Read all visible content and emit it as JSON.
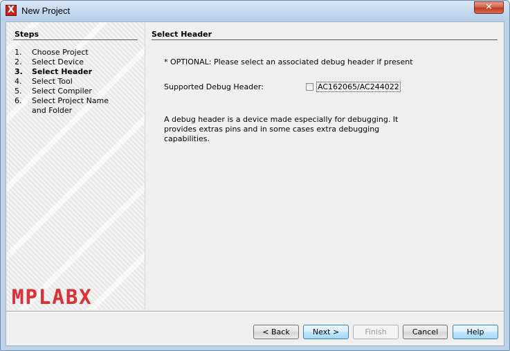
{
  "window": {
    "title": "New Project",
    "app_icon": "mplab-x-icon",
    "app_icon_glyph": "X",
    "close_glyph": "✕"
  },
  "steps": {
    "title": "Steps",
    "current_index": 2,
    "items": [
      {
        "num": "1.",
        "label": "Choose Project"
      },
      {
        "num": "2.",
        "label": "Select Device"
      },
      {
        "num": "3.",
        "label": "Select Header"
      },
      {
        "num": "4.",
        "label": "Select Tool"
      },
      {
        "num": "5.",
        "label": "Select Compiler"
      },
      {
        "num": "6.",
        "label": "Select Project Name and Folder"
      }
    ],
    "logo_text": "MPLABX"
  },
  "content": {
    "title": "Select Header",
    "optional_text": "* OPTIONAL: Please select an associated debug header if present",
    "supported_label": "Supported Debug Header:",
    "checkbox": {
      "label": "AC162065/AC244022",
      "checked": false
    },
    "description": "A debug header is a device made especially for debugging. It provides extras pins and in some cases extra debugging capabilities."
  },
  "buttons": {
    "back": "< Back",
    "next": "Next >",
    "finish": "Finish",
    "cancel": "Cancel",
    "help": "Help"
  },
  "colors": {
    "logo_red": "#d8323a",
    "close_red": "#c13a22",
    "title_bar": "#c2d7ec"
  }
}
